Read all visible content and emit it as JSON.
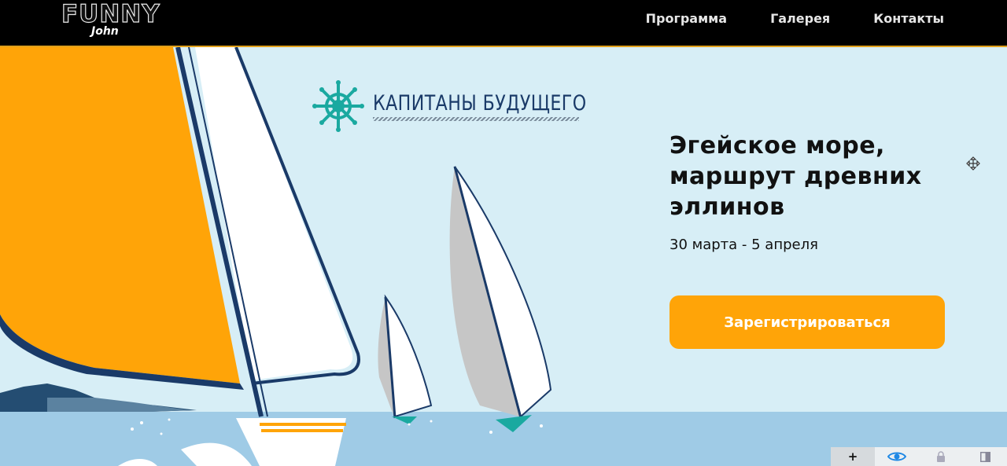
{
  "header": {
    "logo_main": "FUNNY",
    "logo_sub": "John",
    "nav": [
      "Программа",
      "Галерея",
      "Контакты"
    ]
  },
  "hero": {
    "brand": "КАПИТАНЫ БУДУЩЕГО",
    "headline_lines": [
      "Эгейское море,",
      "маршрут древних",
      "эллинов"
    ],
    "dates": "30 марта - 5 апреля",
    "register_label": "Зарегистрироваться"
  },
  "toolbar": {
    "plus_label": "+",
    "icons": [
      "eye-icon",
      "lock-icon",
      "contrast-icon"
    ]
  },
  "colors": {
    "accent": "#ffa408",
    "sky": "#d7eef6",
    "sea": "#9fcbe6",
    "navy": "#1a3a68",
    "teal": "#1aa9a0"
  }
}
